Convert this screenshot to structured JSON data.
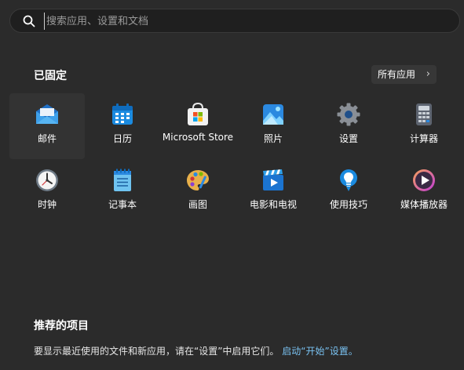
{
  "search": {
    "placeholder": "搜索应用、设置和文档",
    "icon": "search-icon"
  },
  "pinned": {
    "title": "已固定",
    "all_apps_label": "所有应用",
    "apps": [
      {
        "label": "邮件",
        "icon": "mail-icon",
        "selected": true
      },
      {
        "label": "日历",
        "icon": "calendar-icon"
      },
      {
        "label": "Microsoft Store",
        "icon": "store-icon"
      },
      {
        "label": "照片",
        "icon": "photos-icon"
      },
      {
        "label": "设置",
        "icon": "settings-gear-icon"
      },
      {
        "label": "计算器",
        "icon": "calculator-icon"
      },
      {
        "label": "时钟",
        "icon": "clock-icon"
      },
      {
        "label": "记事本",
        "icon": "notepad-icon"
      },
      {
        "label": "画图",
        "icon": "paint-palette-icon"
      },
      {
        "label": "电影和电视",
        "icon": "movies-tv-icon"
      },
      {
        "label": "使用技巧",
        "icon": "tips-bulb-icon"
      },
      {
        "label": "媒体播放器",
        "icon": "media-player-icon"
      }
    ]
  },
  "recommended": {
    "title": "推荐的项目",
    "text": "要显示最近使用的文件和新应用，请在“设置”中启用它们。",
    "link": "启动“开始”设置。"
  },
  "colors": {
    "background": "#2b2b2b",
    "accent": "#0078d4",
    "link": "#79c1f0"
  }
}
